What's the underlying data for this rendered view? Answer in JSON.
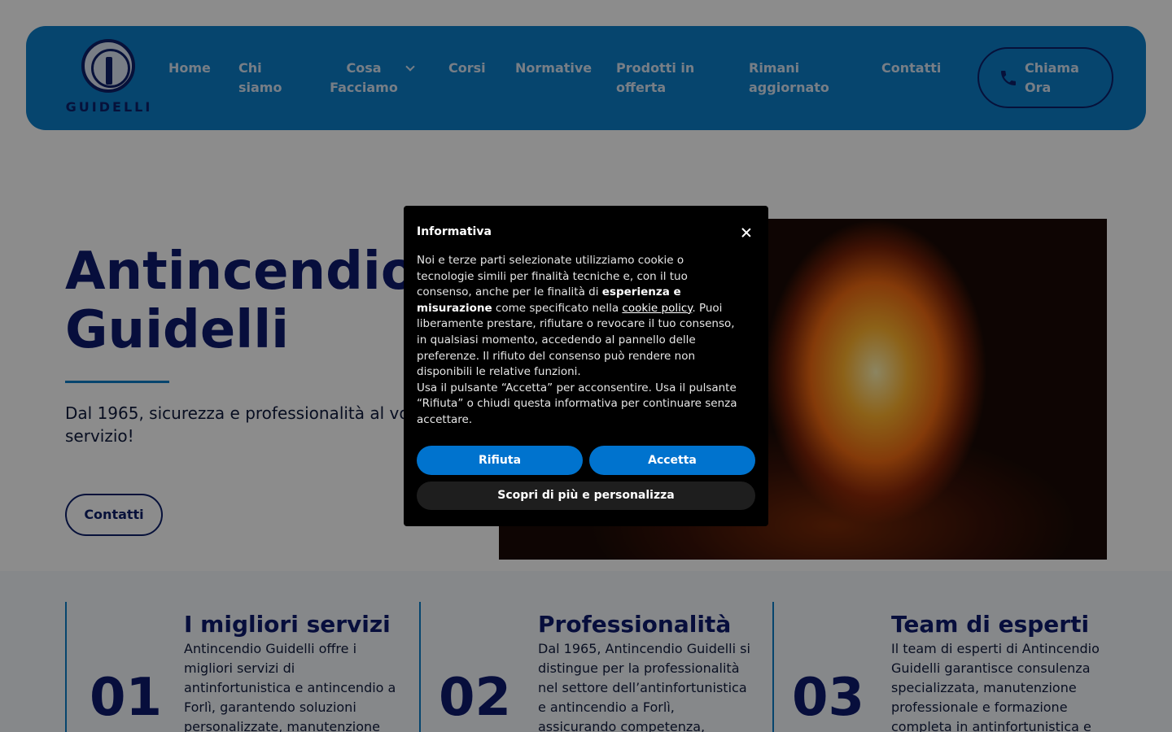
{
  "header": {
    "logo_text": "GUIDELLI",
    "nav": [
      {
        "label": "Home"
      },
      {
        "label": "Chi siamo"
      },
      {
        "label": "Cosa Facciamo"
      },
      {
        "label": "Corsi"
      },
      {
        "label": "Normative"
      },
      {
        "label": "Prodotti in offerta"
      },
      {
        "label": "Rimani aggiornato"
      },
      {
        "label": "Contatti"
      }
    ],
    "call_button": "Chiama Ora"
  },
  "hero": {
    "title": "Antincendio\nGuidelli",
    "subtitle": "Dal 1965, sicurezza e professionalità al vostro servizio!",
    "button": "Contatti"
  },
  "features": [
    {
      "number": "01",
      "title": "I migliori servizi",
      "text": "Antincendio Guidelli offre i migliori servizi di antinfortunistica e antincendio a Forlì, garantendo soluzioni personalizzate, manutenzione"
    },
    {
      "number": "02",
      "title": "Professionalità",
      "text": "Dal 1965, Antincendio Guidelli si distingue per la professionalità nel settore dell’antinfortunistica e antincendio a Forlì, assicurando competenza,"
    },
    {
      "number": "03",
      "title": "Team di esperti",
      "text": "Il team di esperti di Antincendio Guidelli garantisce consulenza specializzata, manutenzione professionale e formazione completa in antinfortunistica e"
    }
  ],
  "cookie": {
    "title": "Informativa",
    "p1_a": "Noi e terze parti selezionate utilizziamo cookie o tecnologie simili per finalità tecniche e, con il tuo consenso, anche per le finalità di ",
    "p1_b": "esperienza e misurazione",
    "p1_c": " come specificato nella ",
    "p1_link": "cookie policy",
    "p1_d": ". Puoi liberamente prestare, rifiutare o revocare il tuo consenso, in qualsiasi momento, accedendo al pannello delle preferenze. Il rifiuto del consenso può rendere non disponibili le relative funzioni.",
    "p2": "Usa il pulsante “Accetta” per acconsentire. Usa il pulsante “Rifiuta” o chiudi questa informativa per continuare senza accettare.",
    "reject": "Rifiuta",
    "accept": "Accetta",
    "customize": "Scopri di più e personalizza"
  }
}
